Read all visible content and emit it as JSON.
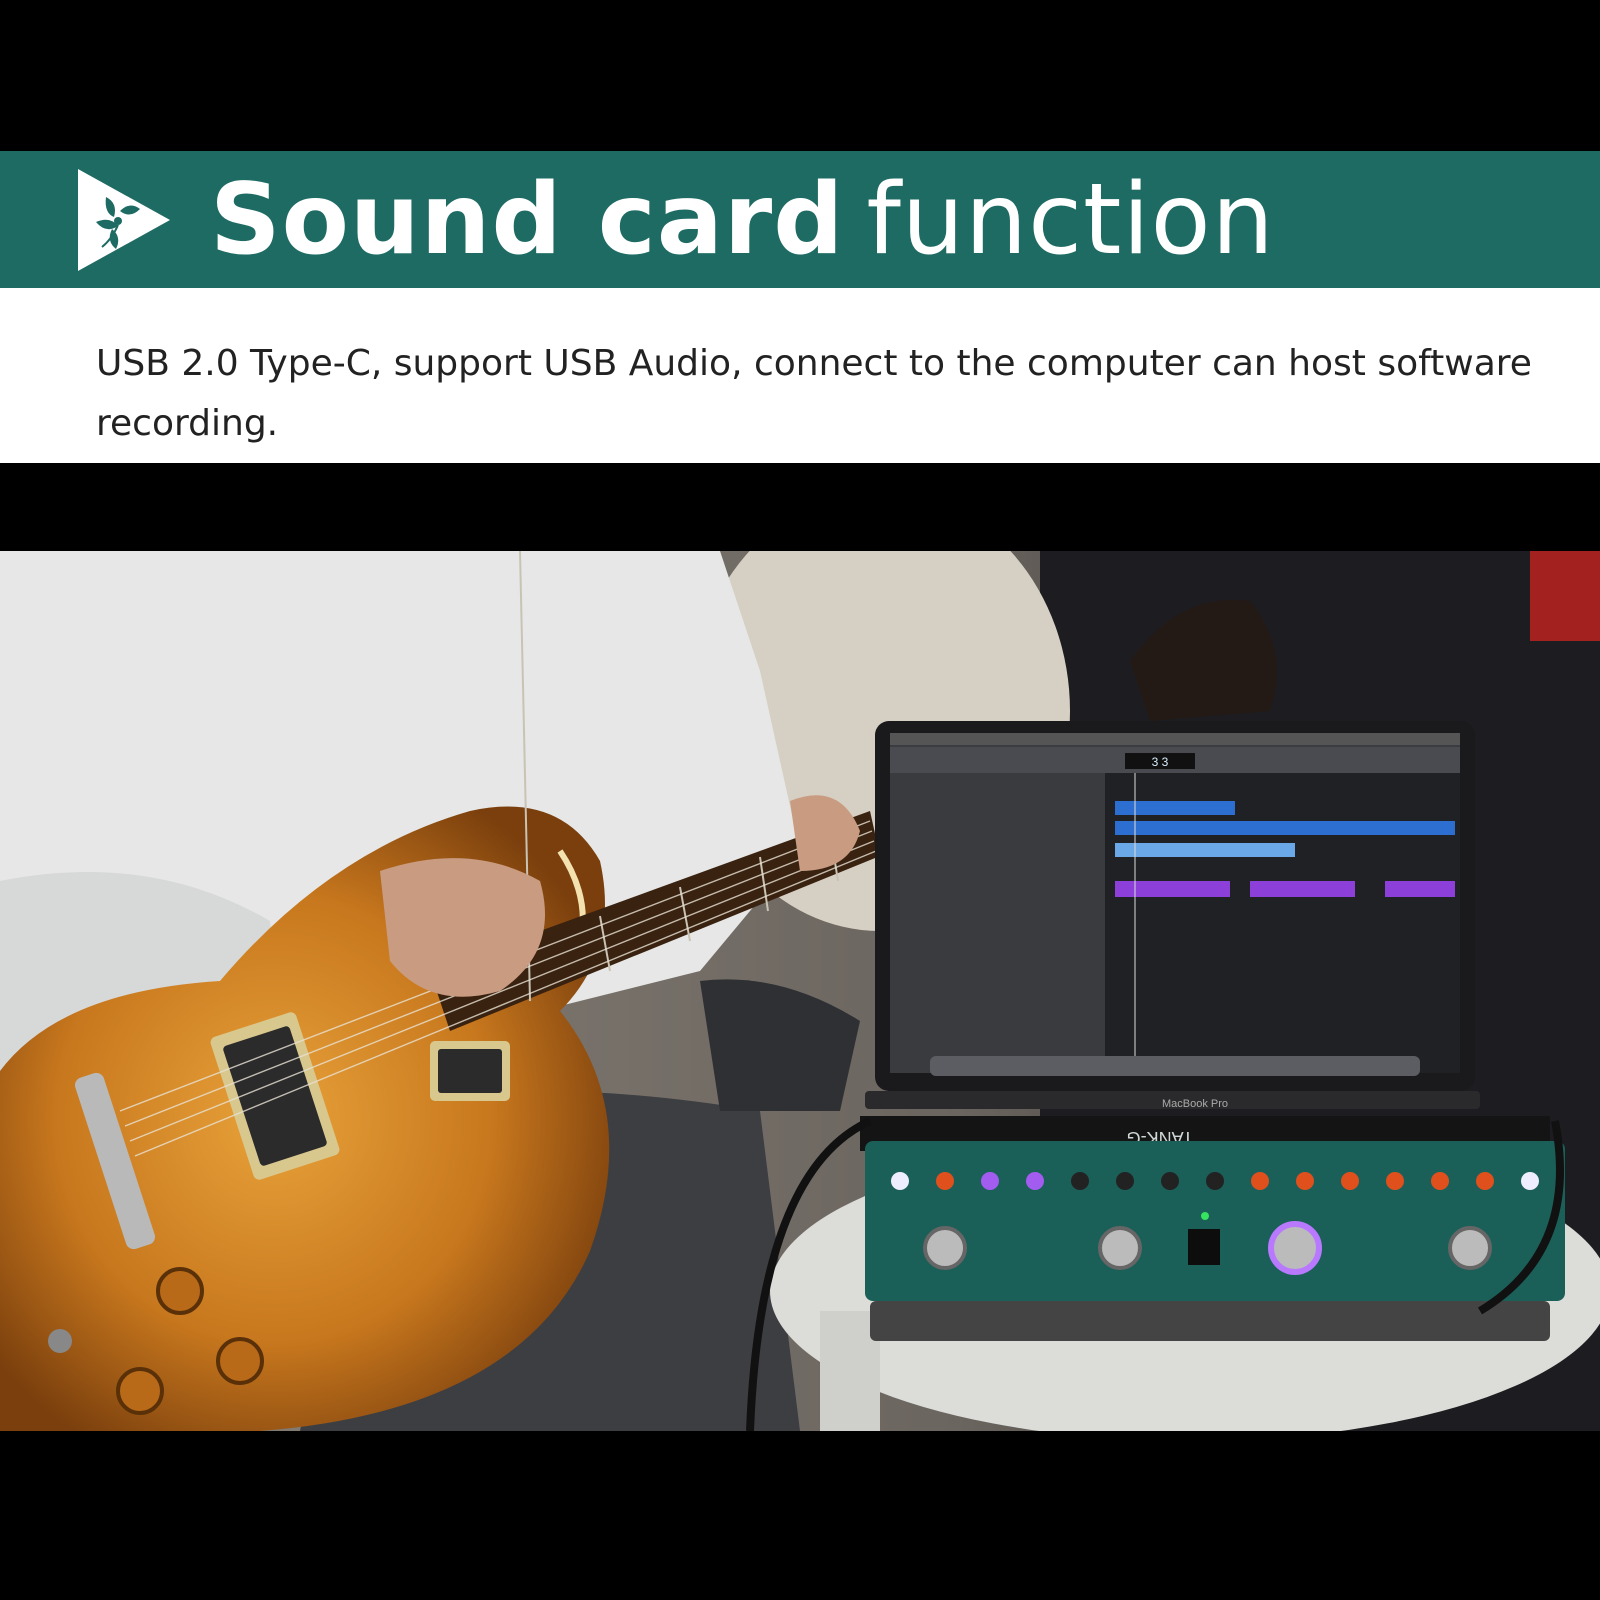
{
  "banner": {
    "title_bold": "Sound card",
    "title_light": "function",
    "logo_icon": "play-triangle-flower-logo",
    "background_color": "#1e6b63"
  },
  "description": {
    "text": "USB 2.0 Type-C, support USB Audio, connect to the computer can host software recording."
  },
  "photo": {
    "subject": "guitarist-with-laptop-and-multi-effects-pedal",
    "device_label": "TANK-G",
    "laptop_label": "MacBook Pro",
    "counter": "3 3"
  }
}
